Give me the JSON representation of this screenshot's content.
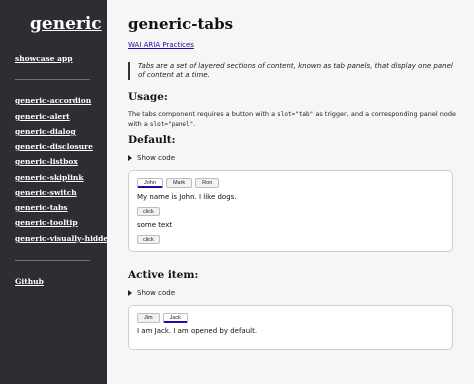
{
  "sidebar": {
    "brand": "generic",
    "showcase": "showcase app",
    "components": [
      "generic-accordion",
      "generic-alert",
      "generic-dialog",
      "generic-disclosure",
      "generic-listbox",
      "generic-skiplink",
      "generic-switch",
      "generic-tabs",
      "generic-tooltip",
      "generic-visually-hidden"
    ],
    "github": "Github"
  },
  "main": {
    "title": "generic-tabs",
    "aria_link": "WAI ARIA Practices",
    "quote": "Tabs are a set of layered sections of content, known as tab panels, that display one panel of content at a time.",
    "usage_heading": "Usage:",
    "usage_pre": "The tabs component requires a button with a ",
    "usage_code1": "slot=\"tab\"",
    "usage_mid": " as trigger, and a corresponding panel node with a ",
    "usage_code2": "slot=\"panel\"",
    "usage_post": ".",
    "default_heading": "Default:",
    "show_code": "Show code",
    "default_demo": {
      "tabs": [
        "John",
        "Mark",
        "Ron"
      ],
      "panel_text": "My name is John. I like dogs.",
      "button1": "click",
      "some_text": "some text",
      "button2": "click"
    },
    "active_heading": "Active item:",
    "show_code_2": "Show code",
    "active_demo": {
      "tabs": [
        "Jim",
        "Jack"
      ],
      "panel_text": "I am Jack. I am opened by default."
    }
  }
}
